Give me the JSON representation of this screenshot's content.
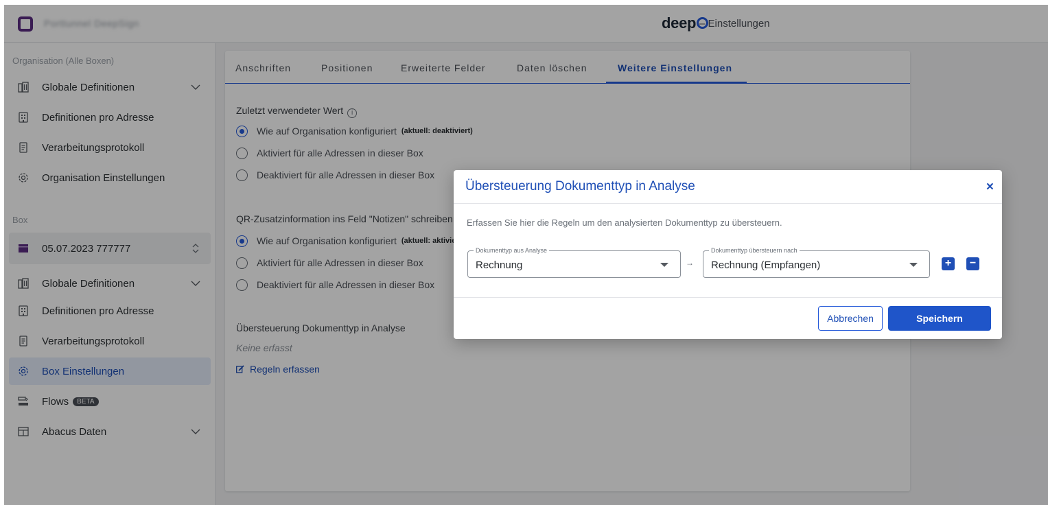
{
  "topbar": {
    "org_name": "Porttunnel DeepSign",
    "brand": "deep",
    "brand_suffix": "– Einstellungen"
  },
  "sidebar": {
    "section_org": "Organisation (Alle Boxen)",
    "org_items": [
      {
        "label": "Globale Definitionen",
        "icon": "building-grid-icon"
      },
      {
        "label": "Definitionen pro Adresse",
        "icon": "building-icon"
      },
      {
        "label": "Verarbeitungsprotokoll",
        "icon": "document-icon"
      },
      {
        "label": "Organisation Einstellungen",
        "icon": "gear-icon"
      }
    ],
    "section_box": "Box",
    "box_selector": "05.07.2023 777777",
    "box_items": [
      {
        "label": "Globale Definitionen",
        "icon": "building-grid-icon"
      },
      {
        "label": "Definitionen pro Adresse",
        "icon": "building-icon"
      },
      {
        "label": "Verarbeitungsprotokoll",
        "icon": "document-icon"
      },
      {
        "label": "Box Einstellungen",
        "icon": "gear-icon"
      },
      {
        "label": "Flows",
        "icon": "flow-icon",
        "badge": "BETA"
      },
      {
        "label": "Abacus Daten",
        "icon": "table-icon"
      }
    ]
  },
  "tabs": [
    "Anschriften",
    "Positionen",
    "Erweiterte Felder",
    "Daten löschen",
    "Weitere Einstellungen"
  ],
  "settings": {
    "last_value_title": "Zuletzt verwendeter Wert",
    "last_value_options": [
      {
        "label": "Wie auf Organisation konfiguriert",
        "note": "(aktuell: deaktiviert)",
        "selected": true
      },
      {
        "label": "Aktiviert für alle Adressen in dieser Box",
        "selected": false
      },
      {
        "label": "Deaktiviert für alle Adressen in dieser Box",
        "selected": false
      }
    ],
    "qr_title": "QR-Zusatzinformation ins Feld \"Notizen\" schreiben",
    "qr_options": [
      {
        "label": "Wie auf Organisation konfiguriert",
        "note": "(aktuell: aktiviert)",
        "selected": true
      },
      {
        "label": "Aktiviert für alle Adressen in dieser Box",
        "selected": false
      },
      {
        "label": "Deaktiviert für alle Adressen in dieser Box",
        "selected": false
      }
    ],
    "override_title": "Übersteuerung Dokumenttyp in Analyse",
    "override_empty": "Keine erfasst",
    "override_link": "Regeln erfassen"
  },
  "modal": {
    "title": "Übersteuerung Dokumenttyp in Analyse",
    "close": "×",
    "description": "Erfassen Sie hier die Regeln um den analysierten Dokumenttyp zu übersteuern.",
    "field_from_label": "Dokumenttyp aus Analyse",
    "field_from_value": "Rechnung",
    "arrow": "→",
    "field_to_label": "Dokumenttyp übersteuern nach",
    "field_to_value": "Rechnung (Empfangen)",
    "add": "+",
    "remove": "−",
    "cancel": "Abbrechen",
    "save": "Speichern"
  },
  "colors": {
    "accent": "#1f4fb6",
    "brand_purple": "#5b2d82"
  }
}
